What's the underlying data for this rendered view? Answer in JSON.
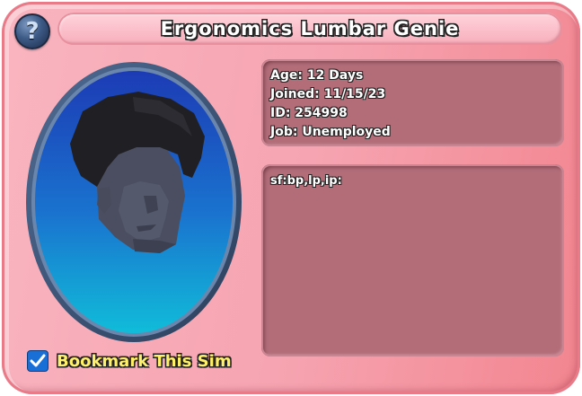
{
  "title": "Ergonomics Lumbar Genie",
  "help_icon": "question-mark-icon",
  "help_glyph": "?",
  "info": {
    "age": "Age: 12 Days",
    "joined": "Joined: 11/15/23",
    "id": "ID: 254998",
    "job": "Job: Unemployed"
  },
  "description": "sf:bp,lp,ip:",
  "bookmark": {
    "label": "Bookmark This Sim",
    "checked": true
  },
  "colors": {
    "card_pink": "#f6a3b0",
    "panel_mauve": "#b26d79",
    "portrait_blue_top": "#1e3fb8",
    "portrait_blue_bottom": "#0fb3d8",
    "bookmark_text": "#fff06a",
    "checkbox_blue": "#1a6fd6"
  }
}
